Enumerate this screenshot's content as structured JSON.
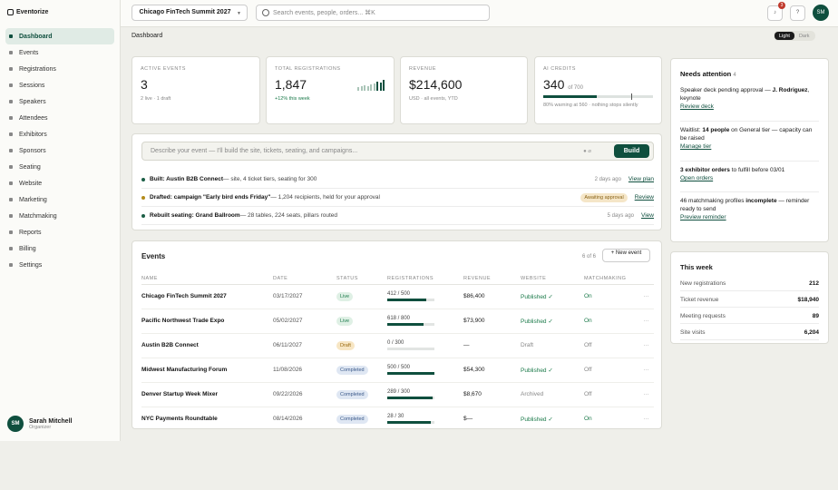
{
  "app": {
    "logo_text": "Eventorize"
  },
  "sidebar": {
    "items": [
      {
        "label": "Dashboard",
        "active": true
      },
      {
        "label": "Events"
      },
      {
        "label": "Registrations"
      },
      {
        "label": "Sessions"
      },
      {
        "label": "Speakers"
      },
      {
        "label": "Attendees"
      },
      {
        "label": "Exhibitors"
      },
      {
        "label": "Sponsors"
      },
      {
        "label": "Seating"
      },
      {
        "label": "Website"
      },
      {
        "label": "Marketing"
      },
      {
        "label": "Matchmaking"
      },
      {
        "label": "Reports"
      },
      {
        "label": "Billing"
      },
      {
        "label": "Settings"
      }
    ],
    "user": {
      "initials": "SM",
      "name": "Sarah Mitchell",
      "role": "Organizer"
    }
  },
  "topbar": {
    "event_select": "Chicago FinTech Summit 2027",
    "search_placeholder": "Search events, people, orders...  ⌘K",
    "notifications_count": "3",
    "help_icon": "?",
    "avatar": "SM"
  },
  "breadcrumb": "Dashboard",
  "theme": {
    "light": "Light",
    "dark": "Dark"
  },
  "stats": [
    {
      "label": "ACTIVE EVENTS",
      "value": "3",
      "sub": "2 live · 1 draft"
    },
    {
      "label": "TOTAL REGISTRATIONS",
      "value": "1,847",
      "sub": "+12% this week"
    },
    {
      "label": "REVENUE",
      "value": "$214,600",
      "sub": "USD · all events, YTD"
    },
    {
      "label": "AI CREDITS",
      "value": "340",
      "value_suffix": "of 700",
      "sub": "80% warning at 560 · nothing stops silently",
      "used_fraction": 0.486,
      "warning_fraction": 0.8
    }
  ],
  "assistant": {
    "placeholder": "Describe your event — I'll build the site, tickets, seating, and campaigns...",
    "build_label": "Build",
    "activity": [
      {
        "bullet_color": "#1b5e46",
        "title": "Built: Austin B2B Connect",
        "desc": " — site, 4 ticket tiers, seating for 300",
        "time": "2 days ago",
        "link": "View plan"
      },
      {
        "bullet_color": "#b38b1a",
        "title": "Drafted: campaign \"Early bird ends Friday\"",
        "desc": " — 1,204 recipients, held for your approval",
        "badge": "Awaiting approval",
        "link": "Review"
      },
      {
        "bullet_color": "#1b5e46",
        "title": "Rebuilt seating: Grand Ballroom",
        "desc": " — 28 tables, 224 seats, pillars routed",
        "time": "5 days ago",
        "link": "View"
      }
    ]
  },
  "events": {
    "title": "Events",
    "count": "6 of 6",
    "new_button": "+ New event",
    "columns": [
      "NAME",
      "DATE",
      "STATUS",
      "REGISTRATIONS",
      "REVENUE",
      "WEBSITE",
      "MATCHMAKING"
    ],
    "rows": [
      {
        "name": "Chicago FinTech Summit 2027",
        "date": "03/17/2027",
        "status": "Live",
        "reg": "412 / 500",
        "reg_fraction": 0.82,
        "revenue": "$86,400",
        "website": "Published ✓",
        "matchmaking": "On"
      },
      {
        "name": "Pacific Northwest Trade Expo",
        "date": "05/02/2027",
        "status": "Live",
        "reg": "618 / 800",
        "reg_fraction": 0.77,
        "revenue": "$73,900",
        "website": "Published ✓",
        "matchmaking": "On"
      },
      {
        "name": "Austin B2B Connect",
        "date": "06/11/2027",
        "status": "Draft",
        "reg": "0 / 300",
        "reg_fraction": 0.0,
        "revenue": "—",
        "website": "Draft",
        "matchmaking": "Off"
      },
      {
        "name": "Midwest Manufacturing Forum",
        "date": "11/08/2026",
        "status": "Completed",
        "reg": "500 / 500",
        "reg_fraction": 1.0,
        "revenue": "$54,300",
        "website": "Published ✓",
        "matchmaking": "Off"
      },
      {
        "name": "Denver Startup Week Mixer",
        "date": "09/22/2026",
        "status": "Completed",
        "reg": "289 / 300",
        "reg_fraction": 0.96,
        "revenue": "$8,670",
        "website": "Archived",
        "matchmaking": "Off"
      },
      {
        "name": "NYC Payments Roundtable",
        "date": "08/14/2026",
        "status": "Completed",
        "reg": "28 / 30",
        "reg_fraction": 0.93,
        "revenue": "$—",
        "website": "Published ✓",
        "matchmaking": "On"
      }
    ],
    "more": "···"
  },
  "attention": {
    "title": "Needs attention",
    "count": "4",
    "items": [
      {
        "pre": "Speaker deck pending approval — ",
        "bold": "J. Rodriguez",
        "post": ", keynote",
        "link": "Review deck"
      },
      {
        "pre": "Waitlist: ",
        "bold": "14 people",
        "post": " on General tier — capacity can be raised",
        "link": "Manage tier"
      },
      {
        "pre": "",
        "bold": "3 exhibitor orders",
        "post": " to fulfill before 03/01",
        "link": "Open orders"
      },
      {
        "pre": "46 matchmaking profiles ",
        "bold": "incomplete",
        "post": " — reminder ready to send",
        "link": "Preview reminder"
      }
    ]
  },
  "this_week": {
    "title": "This week",
    "rows": [
      {
        "label": "New registrations",
        "value": "212"
      },
      {
        "label": "Ticket revenue",
        "value": "$18,940"
      },
      {
        "label": "Meeting requests",
        "value": "89"
      },
      {
        "label": "Site visits",
        "value": "6,204"
      }
    ]
  },
  "colors": {
    "accent": "#0f4f3e",
    "status_live_bg": "#dff0e5",
    "status_live_fg": "#1b7a4a",
    "status_draft_bg": "#f7e6c4",
    "status_draft_fg": "#9a6a10",
    "status_completed_bg": "#dfe7f3",
    "status_completed_fg": "#3c5a8a"
  }
}
